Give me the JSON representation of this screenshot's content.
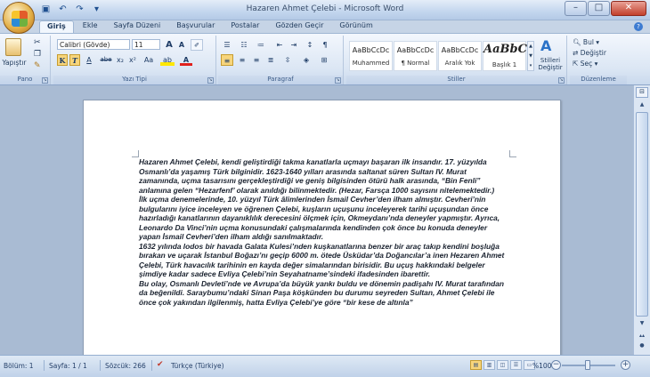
{
  "window": {
    "title": "Hazaren Ahmet Çelebi - Microsoft Word",
    "controls": [
      "–",
      "□",
      "✕"
    ]
  },
  "tabs": [
    "Giriş",
    "Ekle",
    "Sayfa Düzeni",
    "Başvurular",
    "Postalar",
    "Gözden Geçir",
    "Görünüm"
  ],
  "ribbon": {
    "clipboard": {
      "paste_label": "Yapıştır",
      "group_label": "Pano"
    },
    "font": {
      "font_name": "Calibri (Gövde)",
      "font_size": "11",
      "group_label": "Yazı Tipi",
      "bold": "K",
      "italic": "T",
      "underline": "A",
      "strike": "abe",
      "sub": "x₂",
      "sup": "x²",
      "case": "Aa",
      "grow": "A",
      "shrink": "A"
    },
    "paragraph": {
      "group_label": "Paragraf"
    },
    "styles": {
      "group_label": "Stiller",
      "items": [
        {
          "sample": "AaBbCcDc",
          "name": "Muhammed"
        },
        {
          "sample": "AaBbCcDc",
          "name": "¶ Normal"
        },
        {
          "sample": "AaBbCcDc",
          "name": "Aralık Yok"
        },
        {
          "sample": "AaBbC(",
          "name": "Başlık 1"
        }
      ],
      "change_styles": "Stilleri Değiştir"
    },
    "editing": {
      "group_label": "Düzenleme",
      "find": "Bul",
      "replace": "Değiştir",
      "select": "Seç"
    }
  },
  "document": {
    "paragraphs": [
      "Hazaren Ahmet Çelebi, kendi geliştirdiği takma kanatlarla uçmayı başaran ilk insandır. 17. yüzyılda Osmanlı’da yaşamış Türk bilginidir. 1623-1640 yılları arasında saltanat süren Sultan IV. Murat zamanında, uçma tasarısını gerçekleştirdiği ve geniş bilgisinden ötürü halk arasında, “Bin Fenli” anlamına gelen “Hezarfenf’ olarak anıldığı bilinmektedir. (Hezar, Farsça 1000 sayısını nitelemektedir.)",
      "İlk uçma denemelerinde, 10. yüzyıl Türk âlimlerinden İsmail Cevher’den ilham almıştır. Cevheri’nin bulgularını iyice inceleyen ve öğrenen Çelebi, kuşların uçuşunu inceleyerek tarihi uçuşundan önce hazırladığı kanatlarının dayanıklılık derecesini ölçmek için, Okmeydanı’nda deneyler yapmıştır. Ayrıca, Leonardo Da Vinci’nin uçma konusundaki çalışmalarında kendinden çok önce bu konuda deneyler yapan İsmail Cevheri’den ilham aldığı sanılmaktadır.",
      "1632 yılında lodos bir havada Galata Kulesi’nden kuşkanatlarına benzer bir araç takıp kendini boşluğa bırakan ve uçarak İstanbul Boğazı’nı geçip 6000 m. ötede Üsküdar’da Doğancılar’a inen Hezaren Ahmet Çelebi, Türk havacılık tarihinin en kayda değer simalarından birisidir. Bu uçuş hakkındaki belgeler şimdiye kadar sadece Evliya Çelebi’nin Seyahatname’sindeki ifadesinden ibarettir.",
      "Bu olay, Osmanlı Devleti’nde ve Avrupa’da büyük yankı buldu ve dönemin padişahı IV. Murat tarafından da beğenildi. Saraybumu’ndaki Sinan Paşa köşkünden bu durumu seyreden Sultan, Ahmet Çelebi ile önce çok yakından ilgilenmiş, hatta Evliya Çelebi’ye göre “bir kese de altınla”"
    ]
  },
  "status": {
    "section": "Bölüm: 1",
    "page": "Sayfa: 1 / 1",
    "words": "Sözcük: 266",
    "language": "Türkçe (Türkiye)",
    "zoom": "%100",
    "zoom_level": 1.0
  }
}
